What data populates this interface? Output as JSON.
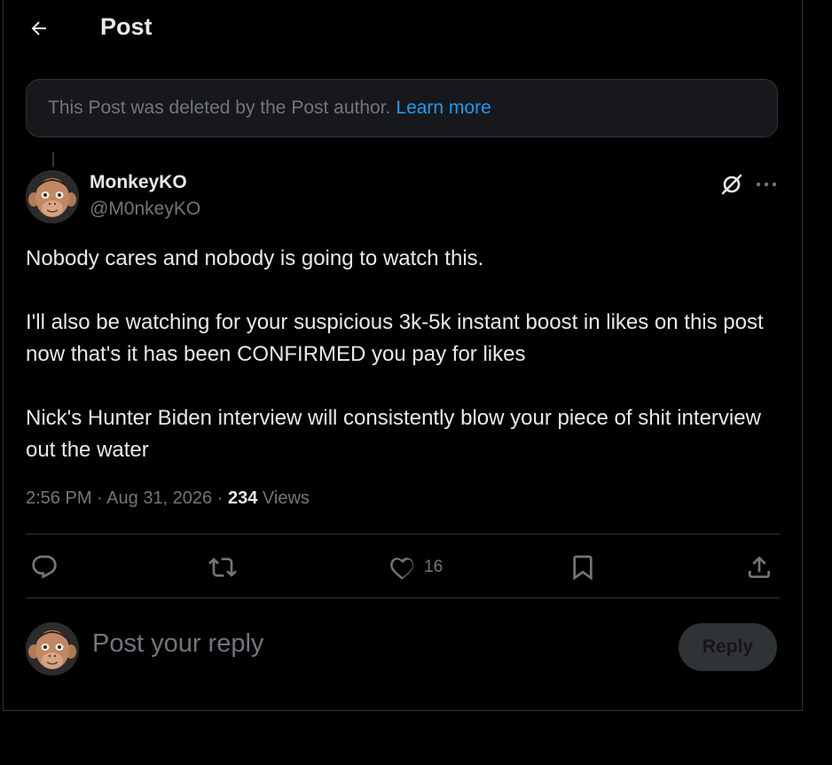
{
  "header": {
    "title": "Post"
  },
  "deleted_notice": {
    "text": "This Post was deleted by the Post author.",
    "link": "Learn more"
  },
  "post": {
    "author_name": "MonkeyKO",
    "author_handle": "@M0nkeyKO",
    "body": [
      "Nobody cares and nobody is going to watch this.",
      "I'll also be watching for your suspicious 3k-5k instant boost in likes on this post now that's it has been CONFIRMED you pay for likes",
      "Nick's Hunter Biden interview will consistently blow your piece of shit interview out the water"
    ],
    "time": "2:56 PM",
    "separator": "·",
    "date": "Aug 31, 2026",
    "views_count": "234",
    "views_label": "Views"
  },
  "actions": {
    "reply_count": "",
    "repost_count": "",
    "like_count": "16",
    "icons": [
      "reply-icon",
      "repost-icon",
      "like-icon",
      "bookmark-icon",
      "share-icon"
    ]
  },
  "composer": {
    "placeholder": "Post your reply",
    "button_label": "Reply"
  },
  "colors": {
    "background": "#000000",
    "text": "#e7e9ea",
    "muted": "#71767b",
    "accent": "#1d9bf0",
    "border": "#2f3336"
  }
}
